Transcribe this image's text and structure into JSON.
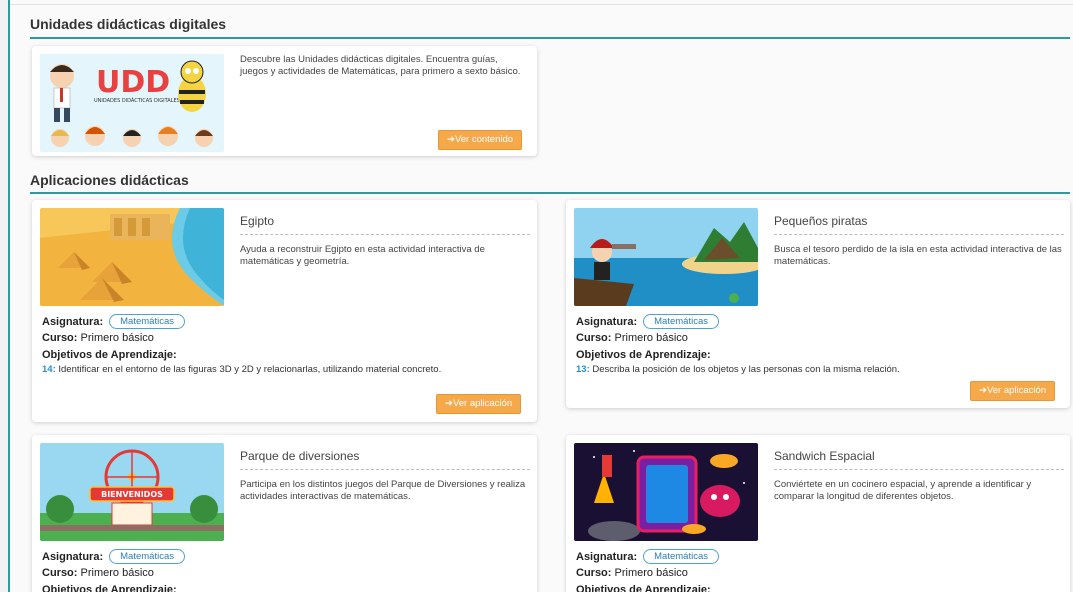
{
  "sections": {
    "udd_title": "Unidades didácticas digitales",
    "apps_title": "Aplicaciones didácticas"
  },
  "udd": {
    "logo_text": "UDD",
    "logo_sub": "UNIDADES DIDÁCTICAS DIGITALES",
    "description": "Descubre las Unidades didácticas digitales. Encuentra guías, juegos y actividades de Matemáticas, para primero a sexto básico.",
    "button": "➔Ver contenido"
  },
  "labels": {
    "asignatura": "Asignatura:",
    "curso": "Curso:",
    "objetivos": "Objetivos de Aprendizaje:",
    "ver_aplicacion": "➔Ver aplicación"
  },
  "apps": [
    {
      "title": "Egipto",
      "description": "Ayuda a reconstruir Egipto en esta actividad interactiva de matemáticas y geometría.",
      "subject": "Matemáticas",
      "course": "Primero básico",
      "objective_num": "14:",
      "objective_text": "Identificar en el entorno de las figuras 3D y 2D y relacionarlas, utilizando material concreto."
    },
    {
      "title": "Pequeños piratas",
      "description": "Busca el tesoro perdido de la isla en esta actividad interactiva de las matemáticas.",
      "subject": "Matemáticas",
      "course": "Primero básico",
      "objective_num": "13:",
      "objective_text": "Describa la posición de los objetos y las personas con la misma relación."
    },
    {
      "title": "Parque de diversiones",
      "description": "Participa en los distintos juegos del Parque de Diversiones y realiza actividades interactivas de matemáticas.",
      "subject": "Matemáticas",
      "course": "Primero básico",
      "banner": "BIENVENIDOS"
    },
    {
      "title": "Sandwich Espacial",
      "description": "Conviértete en un cocinero espacial, y aprende a identificar y comparar la longitud de diferentes objetos.",
      "subject": "Matemáticas",
      "course": "Primero básico"
    }
  ],
  "colors": {
    "accent": "#2a9d9a",
    "button": "#f6a94a",
    "chip_border": "#4da3d6"
  }
}
